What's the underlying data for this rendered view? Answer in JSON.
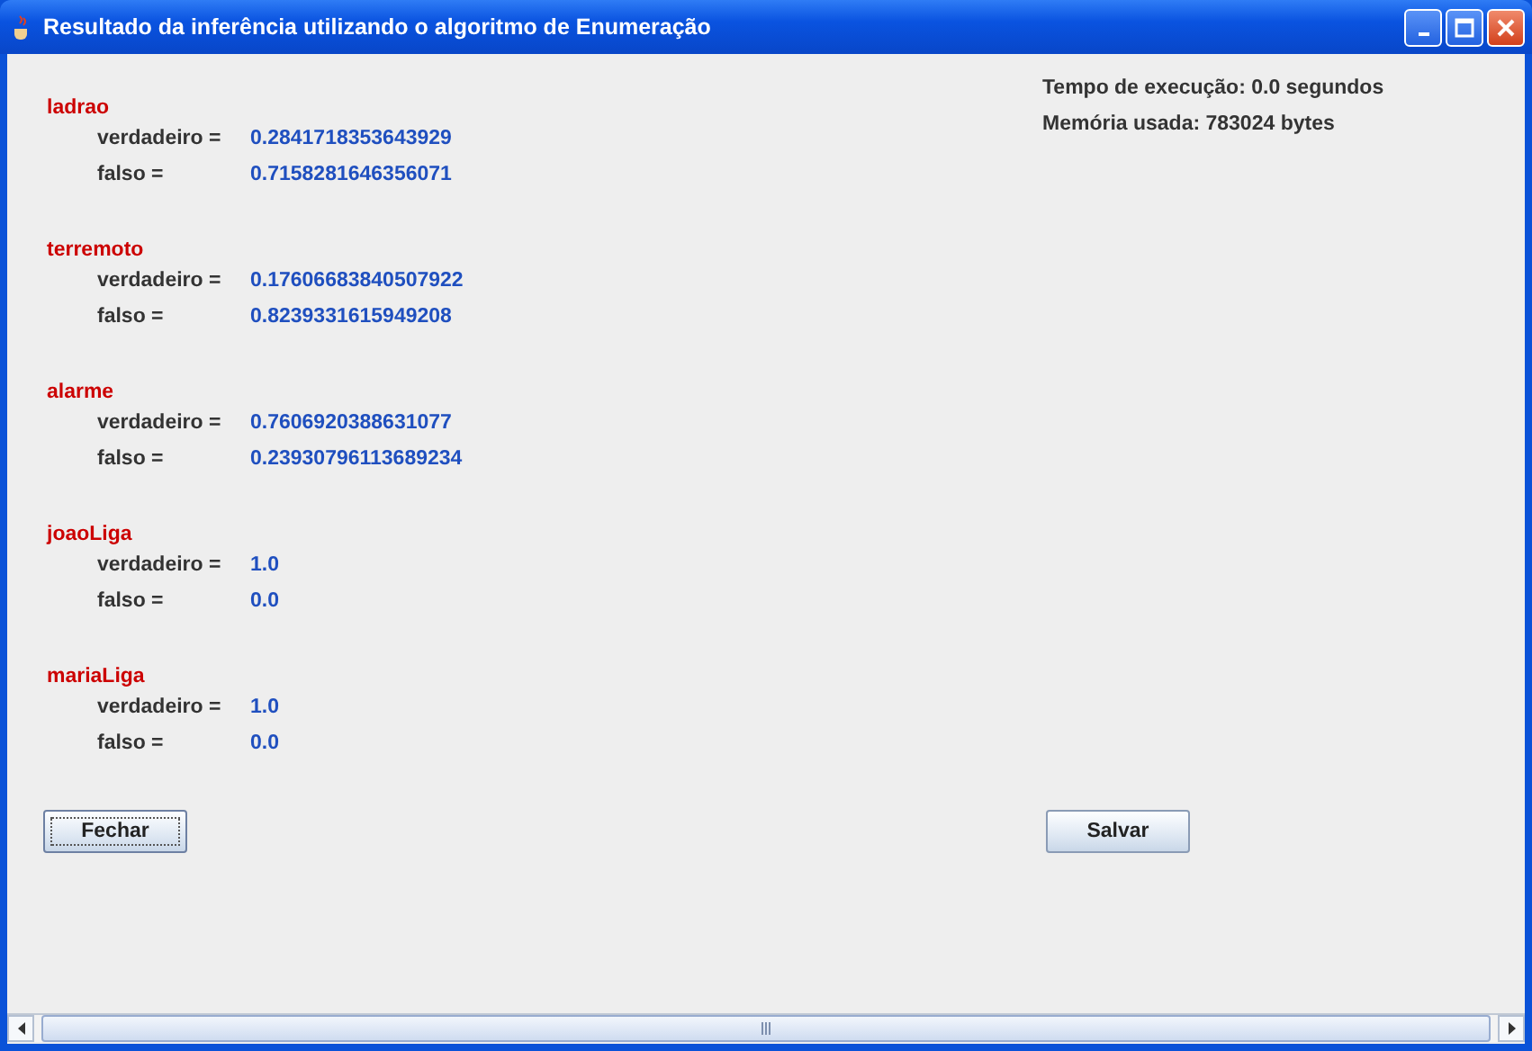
{
  "window": {
    "title": "Resultado da inferência utilizando o algoritmo de Enumeração"
  },
  "variables": [
    {
      "name": "ladrao",
      "rows": [
        {
          "label": "verdadeiro =",
          "value": "0.2841718353643929"
        },
        {
          "label": "falso =",
          "value": "0.7158281646356071"
        }
      ]
    },
    {
      "name": "terremoto",
      "rows": [
        {
          "label": "verdadeiro =",
          "value": "0.17606683840507922"
        },
        {
          "label": "falso =",
          "value": "0.8239331615949208"
        }
      ]
    },
    {
      "name": "alarme",
      "rows": [
        {
          "label": "verdadeiro =",
          "value": "0.7606920388631077"
        },
        {
          "label": "falso =",
          "value": "0.23930796113689234"
        }
      ]
    },
    {
      "name": "joaoLiga",
      "rows": [
        {
          "label": "verdadeiro =",
          "value": "1.0"
        },
        {
          "label": "falso =",
          "value": "0.0"
        }
      ]
    },
    {
      "name": "mariaLiga",
      "rows": [
        {
          "label": "verdadeiro =",
          "value": "1.0"
        },
        {
          "label": "falso =",
          "value": "0.0"
        }
      ]
    }
  ],
  "info": [
    "Tempo de execução:  0.0 segundos",
    "Memória usada:  783024 bytes"
  ],
  "buttons": [
    {
      "label": "Fechar",
      "focused": true
    },
    {
      "label": "Salvar",
      "focused": false
    }
  ]
}
